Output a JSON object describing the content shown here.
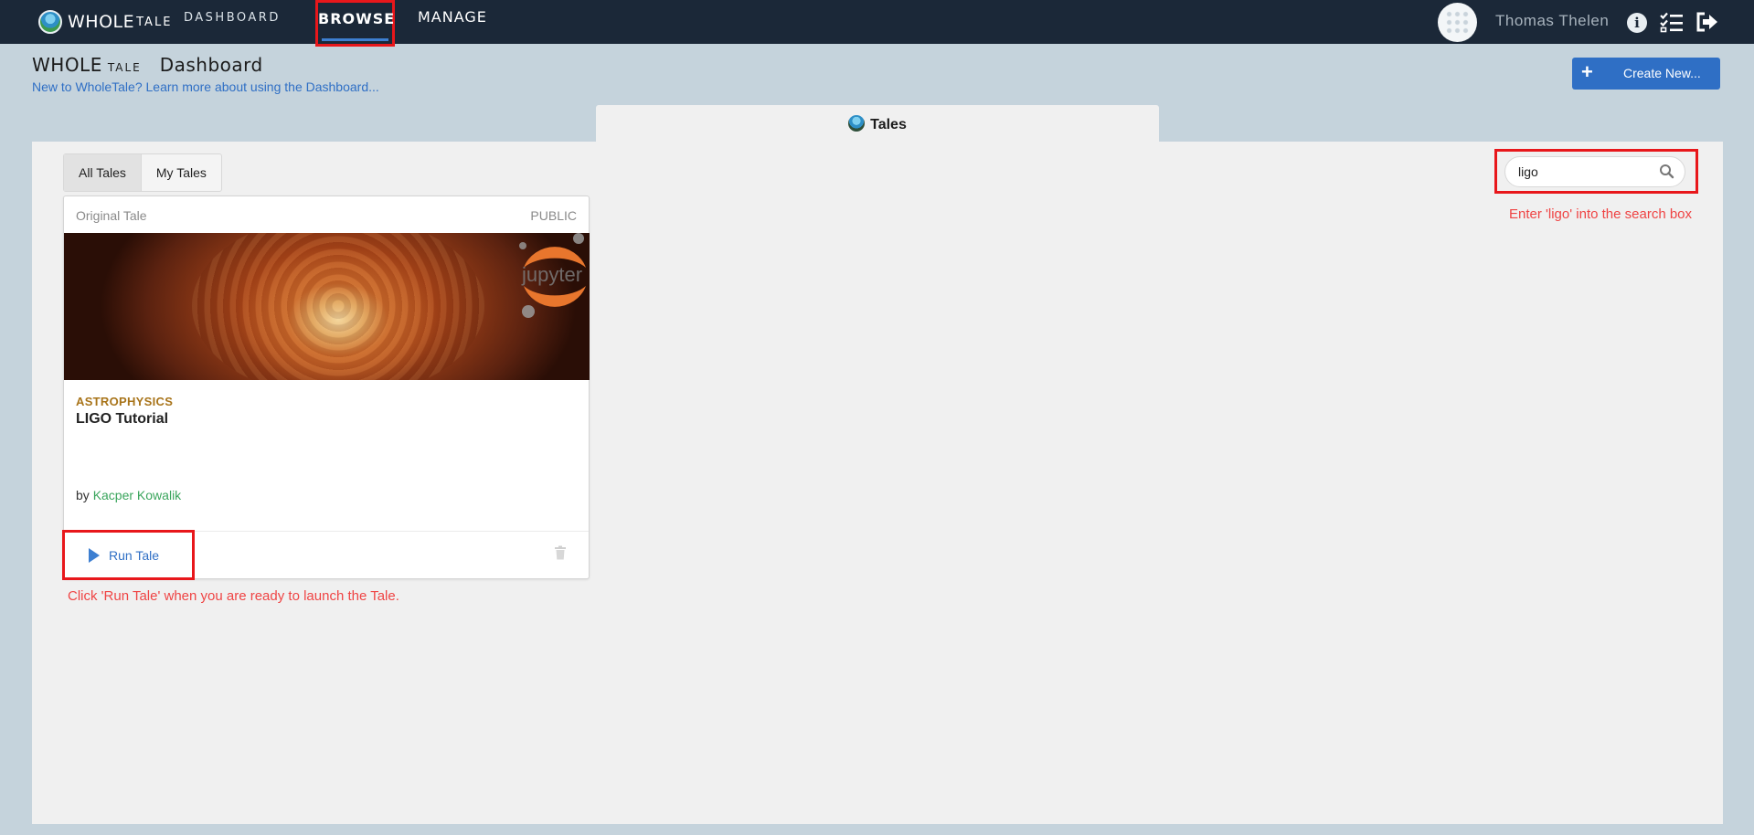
{
  "nav": {
    "brand_main": "WHOLE",
    "brand_small": "TALE",
    "dashboard_label": "DASHBOARD",
    "browse_label": "BROWSE",
    "manage_label": "MANAGE",
    "username": "Thomas Thelen",
    "info_glyph": "i",
    "icons": [
      "wholetale-logo-icon",
      "avatar",
      "info-icon",
      "tasks-icon",
      "logout-icon"
    ]
  },
  "header": {
    "title_main": "WHOLE",
    "title_small": "TALE",
    "title_page": "Dashboard",
    "learn_link": "New to WholeTale? Learn more about using the Dashboard...",
    "create_plus": "+",
    "create_label": "Create New..."
  },
  "tab": {
    "label": "Tales"
  },
  "filters": {
    "all_label": "All Tales",
    "my_label": "My Tales",
    "selected": "All Tales"
  },
  "search": {
    "value": "ligo",
    "placeholder": "Search"
  },
  "annotations": {
    "search_hint": "Enter 'ligo' into the search box",
    "run_hint": "Click 'Run Tale' when you are ready to launch the Tale."
  },
  "card": {
    "origin": "Original Tale",
    "visibility": "PUBLIC",
    "category": "ASTROPHYSICS",
    "title": "LIGO Tutorial",
    "by_prefix": "by",
    "author": "Kacper Kowalik",
    "run_label": "Run Tale",
    "image_badge": "jupyter"
  },
  "colors": {
    "navbar": "#1b2838",
    "accent_blue": "#2f6fc5",
    "annotation_red": "#e8171b",
    "category_gold": "#a8741a",
    "author_green": "#3aa55c"
  }
}
